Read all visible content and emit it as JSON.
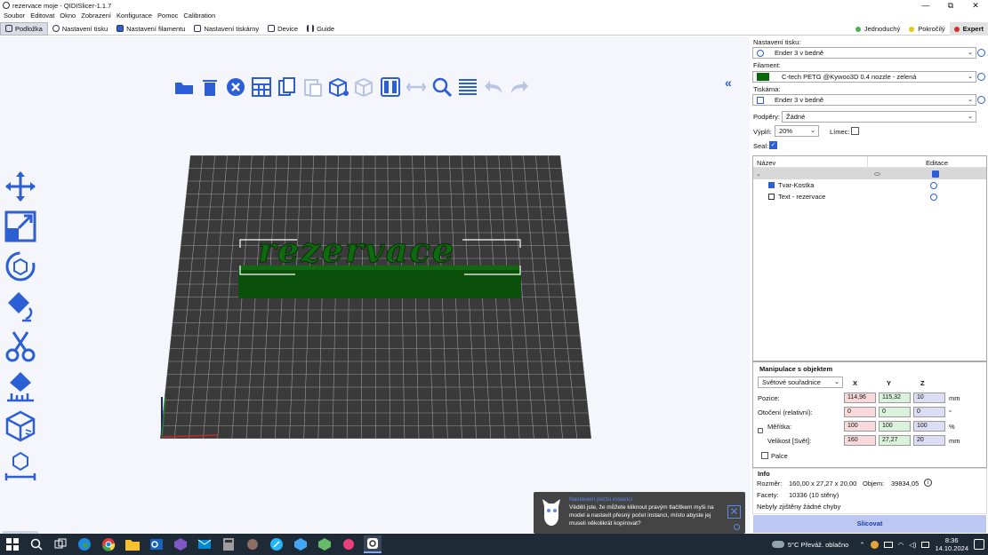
{
  "window": {
    "title": "rezervace moje - QIDISlicer-1.1.7",
    "minimize": "—",
    "restore": "⧉",
    "close": "✕"
  },
  "menu": [
    "Soubor",
    "Editovat",
    "Okno",
    "Zobrazení",
    "Konfigurace",
    "Pomoc",
    "Calibration"
  ],
  "tabs": [
    {
      "label": "Podložka",
      "active": true
    },
    {
      "label": "Nastavení tisku"
    },
    {
      "label": "Nastavení filamentu"
    },
    {
      "label": "Nastavení tiskárny"
    },
    {
      "label": "Device"
    },
    {
      "label": "Guide"
    }
  ],
  "modes": [
    {
      "label": "Jednoduchý",
      "color": "#4caf50"
    },
    {
      "label": "Pokročilý",
      "color": "#e6c619"
    },
    {
      "label": "Expert",
      "color": "#d32f2f",
      "active": true
    }
  ],
  "colors": {
    "accent": "#2c5fd6",
    "model": "#0a5f0a",
    "bed": "#3a3a3a"
  },
  "model": {
    "text": "rezervace"
  },
  "notification": {
    "title": "Nastavení počtu instancí",
    "body": "Věděli jste, že můžete kliknout pravým tlačítkem myši na model a nastavit přesný počet instancí, místo abyste jej museli několikrát kopírovat?"
  },
  "sidebar": {
    "print_settings_label": "Nastavení tisku:",
    "print_settings_value": "Ender 3 v bedně",
    "filament_label": "Filament:",
    "filament_value": "C-tech  PETG @Kywoo3D 0.4 nozzle - zelená",
    "filament_color": "#0a6a0a",
    "printer_label": "Tiskárna:",
    "printer_value": "Ender 3 v bedně",
    "supports_label": "Podpěry:",
    "supports_value": "Žádné",
    "infill_label": "Výplň:",
    "infill_value": "20%",
    "brim_label": "Límec:",
    "seal_label": "Seal:",
    "seal_checked": true,
    "list_headers": {
      "name": "Název",
      "edit": "Editace"
    },
    "objects": [
      {
        "label": "Tvar-Kostka"
      },
      {
        "label": "Text - rezervace"
      }
    ],
    "manip": {
      "title": "Manipulace s objektem",
      "coords": "Světové souřadnice",
      "axes": [
        "X",
        "Y",
        "Z"
      ],
      "position_label": "Pozice:",
      "position": [
        "114,96",
        "115,32",
        "10"
      ],
      "position_unit": "mm",
      "rotation_label": "Otočení (relativní):",
      "rotation": [
        "0",
        "0",
        "0"
      ],
      "rotation_unit": "°",
      "scale_label": "Měřítka:",
      "scale": [
        "100",
        "100",
        "100"
      ],
      "scale_unit": "%",
      "size_label": "Velikost [Svět]:",
      "size": [
        "160",
        "27,27",
        "20"
      ],
      "size_unit": "mm",
      "inches_label": "Palce"
    },
    "info": {
      "title": "Info",
      "size_label": "Rozměr:",
      "size_value": "160,00 x 27,27 x 20,00",
      "volume_label": "Objem:",
      "volume_value": "39834,05",
      "facets_label": "Facety:",
      "facets_value": "10336 (10 stěny)",
      "errors": "Nebyly zjištěny žádné chyby"
    },
    "slice_button": "Slicovat"
  },
  "taskbar": {
    "weather": "5°C  Převáž. oblačno",
    "time": "8:36",
    "date": "14.10.2024"
  }
}
